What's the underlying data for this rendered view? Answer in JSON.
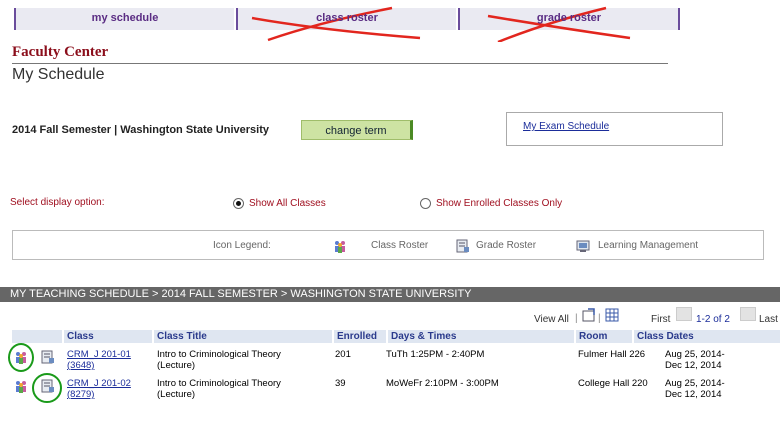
{
  "tabs": [
    {
      "label": "my schedule",
      "struck": false
    },
    {
      "label": "class roster",
      "struck": true
    },
    {
      "label": "grade roster",
      "struck": true
    }
  ],
  "header": {
    "faculty_center": "Faculty Center",
    "page_title": "My Schedule"
  },
  "term": {
    "text": "2014 Fall Semester | Washington State University",
    "change_term_label": "change term",
    "exam_schedule_link": "My Exam Schedule"
  },
  "display_option": {
    "label": "Select display option:",
    "options": [
      {
        "label": "Show All Classes",
        "selected": true
      },
      {
        "label": "Show Enrolled Classes Only",
        "selected": false
      }
    ]
  },
  "legend": {
    "title": "Icon Legend:",
    "items": [
      {
        "icon": "class-roster-icon",
        "label": "Class Roster"
      },
      {
        "icon": "grade-roster-icon",
        "label": "Grade Roster"
      },
      {
        "icon": "learning-management-icon",
        "label": "Learning Management"
      }
    ]
  },
  "schedule": {
    "header": "MY TEACHING SCHEDULE > 2014 FALL SEMESTER > WASHINGTON STATE UNIVERSITY",
    "view_all": "View All",
    "first": "First",
    "range": "1-2 of 2",
    "last": "Last",
    "columns": [
      "Class",
      "Class Title",
      "Enrolled",
      "Days & Times",
      "Room",
      "Class Dates"
    ],
    "rows": [
      {
        "class": "CRM_J 201-01",
        "class_nbr": "(3648)",
        "title": "Intro to Criminological Theory",
        "component": "(Lecture)",
        "enrolled": "201",
        "days_times": "TuTh 1:25PM - 2:40PM",
        "room": "Fulmer Hall 226",
        "dates_1": "Aug 25, 2014-",
        "dates_2": "Dec 12, 2014"
      },
      {
        "class": "CRM_J 201-02",
        "class_nbr": "(8279)",
        "title": "Intro to Criminological Theory",
        "component": "(Lecture)",
        "enrolled": "39",
        "days_times": "MoWeFr 2:10PM - 3:00PM",
        "room": "College Hall 220",
        "dates_1": "Aug 25, 2014-",
        "dates_2": "Dec 12, 2014"
      }
    ]
  },
  "colors": {
    "accent": "#8b0e1b",
    "annotation": "#1a9a1a",
    "strike": "#e2261e"
  }
}
